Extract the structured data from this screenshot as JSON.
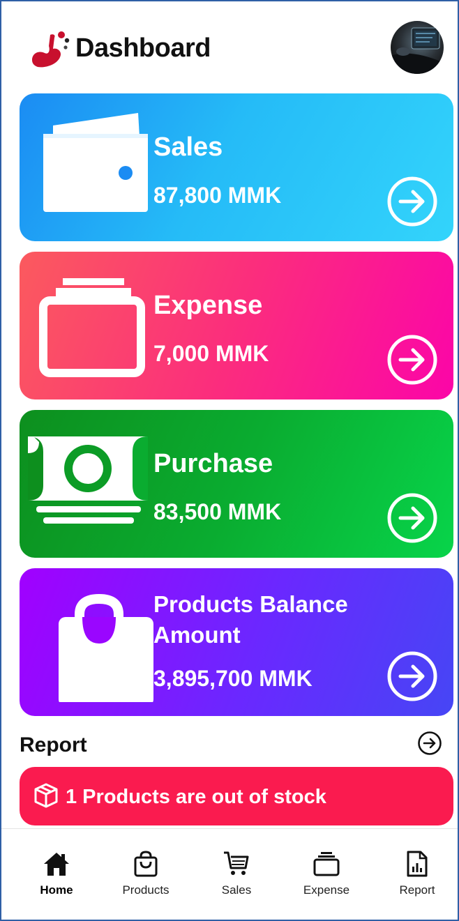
{
  "header": {
    "title": "Dashboard",
    "logo_icon": "app-logo",
    "avatar_icon": "user-avatar"
  },
  "cards": [
    {
      "key": "sales",
      "title": "Sales",
      "value": "87,800 MMK",
      "icon": "wallet-icon",
      "gradient": [
        "#1b8cf3",
        "#33d4fb"
      ]
    },
    {
      "key": "expense",
      "title": "Expense",
      "value": "7,000 MMK",
      "icon": "box-stack-icon",
      "gradient": [
        "#fb5a5e",
        "#fb05a8"
      ]
    },
    {
      "key": "purchase",
      "title": "Purchase",
      "value": "83,500 MMK",
      "icon": "cash-icon",
      "gradient": [
        "#0d8f1e",
        "#08d44a"
      ]
    },
    {
      "key": "products",
      "title": "Products Balance Amount",
      "value": "3,895,700 MMK",
      "icon": "shopping-bag-icon",
      "gradient": [
        "#a100ff",
        "#4646f5"
      ]
    }
  ],
  "report": {
    "title": "Report",
    "icon": "arrow-right-circle-icon"
  },
  "alert": {
    "text": "1 Products are out of stock",
    "icon": "cube-icon",
    "color": "#fa1b4f"
  },
  "nav": {
    "items": [
      {
        "label": "Home",
        "icon": "home-icon",
        "active": true
      },
      {
        "label": "Products",
        "icon": "shopping-bag-icon",
        "active": false
      },
      {
        "label": "Sales",
        "icon": "cart-icon",
        "active": false
      },
      {
        "label": "Expense",
        "icon": "box-stack-icon",
        "active": false
      },
      {
        "label": "Report",
        "icon": "report-icon",
        "active": false
      }
    ]
  }
}
